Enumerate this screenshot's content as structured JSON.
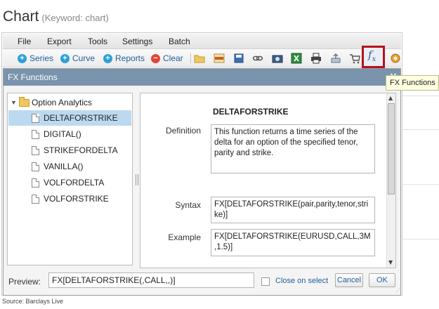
{
  "page": {
    "title": "Chart",
    "keyword": "(Keyword: chart)",
    "source": "Source: Barclays Live"
  },
  "menu": [
    "File",
    "Export",
    "Tools",
    "Settings",
    "Batch"
  ],
  "toolbar": {
    "series": "Series",
    "curve": "Curve",
    "reports": "Reports",
    "clear": "Clear",
    "icons": [
      "folder-icon",
      "tsp-icon",
      "save-icon",
      "link-icon",
      "camera-icon",
      "excel-icon",
      "print-icon",
      "share-icon",
      "cart-icon",
      "fx-icon",
      "gear-icon"
    ],
    "fx_glyph": "f",
    "fx_glyph_sub": "x"
  },
  "tooltip": "FX Functions",
  "dialog": {
    "title": "FX Functions",
    "tree": {
      "root": "Option Analytics",
      "items": [
        "DELTAFORSTRIKE",
        "DIGITAL()",
        "STRIKEFORDELTA",
        "VANILLA()",
        "VOLFORDELTA",
        "VOLFORSTRIKE"
      ],
      "selected": "DELTAFORSTRIKE"
    },
    "detail": {
      "name": "DELTAFORSTRIKE",
      "definition_label": "Definition",
      "definition": "This function returns a time series of the delta for an option of the specified tenor, parity and strike.",
      "syntax_label": "Syntax",
      "syntax": "FX[DELTAFORSTRIKE(pair,parity,tenor,strike)]",
      "example_label": "Example",
      "example": "FX[DELTAFORSTRIKE(EURUSD,CALL,3M,1.5)]"
    },
    "preview_label": "Preview:",
    "preview_value": "FX[DELTAFORSTRIKE(,CALL,,)]",
    "close_on_select": "Close on select",
    "cancel": "Cancel",
    "ok": "OK"
  },
  "colors": {
    "title_bar": "#7a94ad",
    "selection": "#bcd9f0",
    "highlight_border": "#b4131b",
    "link_blue": "#1f5f9a",
    "series_icon": "#2e9fd8",
    "clear_icon": "#e0453a"
  }
}
